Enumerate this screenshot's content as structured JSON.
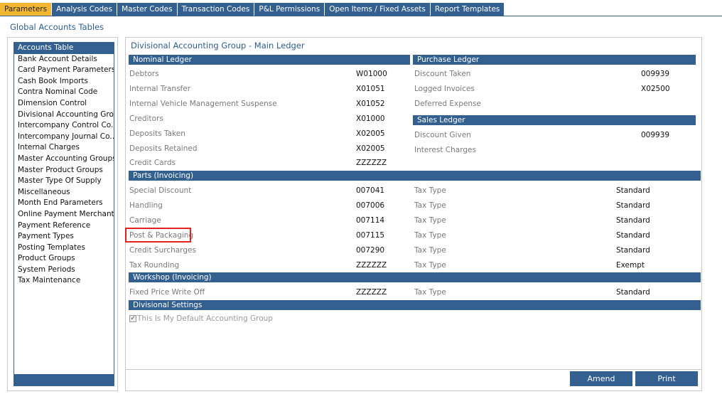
{
  "tabs": [
    {
      "label": "Parameters",
      "active": true
    },
    {
      "label": "Analysis Codes",
      "active": false
    },
    {
      "label": "Master Codes",
      "active": false
    },
    {
      "label": "Transaction Codes",
      "active": false
    },
    {
      "label": "P&L Permissions",
      "active": false
    },
    {
      "label": "Open Items / Fixed Assets",
      "active": false
    },
    {
      "label": "Report Templates",
      "active": false
    }
  ],
  "global_title": "Global Accounts Tables",
  "left_list": [
    "Accounts Table",
    "Bank Account Details",
    "Card Payment Parameters",
    "Cash Book Imports",
    "Contra Nominal Code",
    "Dimension Control",
    "Divisional Accounting Gro...",
    "Intercompany Control Co...",
    "Intercompany Journal Co...",
    "Internal Charges",
    "Master Accounting Groups",
    "Master Product Groups",
    "Master Type Of Supply",
    "Miscellaneous",
    "Month End Parameters",
    "Online Payment Merchants",
    "Payment Reference",
    "Payment Types",
    "Posting Templates",
    "Product Groups",
    "System Periods",
    "Tax Maintenance"
  ],
  "selected_index": 0,
  "main_title": "Divisional Accounting Group - Main Ledger",
  "nominal_ledger": {
    "title": "Nominal Ledger",
    "rows": [
      {
        "label": "Debtors",
        "value": "W01000"
      },
      {
        "label": "Internal Transfer",
        "value": "X01051"
      },
      {
        "label": "Internal Vehicle Management Suspense",
        "value": "X01052"
      },
      {
        "label": "Creditors",
        "value": "X01000"
      },
      {
        "label": "Deposits Taken",
        "value": "X02005"
      },
      {
        "label": "Deposits Retained",
        "value": "X02005"
      },
      {
        "label": "Credit Cards",
        "value": "ZZZZZZ"
      }
    ]
  },
  "purchase_ledger": {
    "title": "Purchase Ledger",
    "rows": [
      {
        "label": "Discount Taken",
        "value": "009939"
      },
      {
        "label": "Logged Invoices",
        "value": "X02500"
      },
      {
        "label": "Deferred Expense",
        "value": ""
      }
    ]
  },
  "sales_ledger": {
    "title": "Sales Ledger",
    "rows": [
      {
        "label": "Discount Given",
        "value": "009939"
      },
      {
        "label": "Interest Charges",
        "value": ""
      }
    ]
  },
  "parts_invoicing": {
    "title": "Parts (Invoicing)",
    "rows": [
      {
        "label": "Special Discount",
        "value": "007041",
        "tax_label": "Tax Type",
        "tax_value": "Standard"
      },
      {
        "label": "Handling",
        "value": "007006",
        "tax_label": "Tax Type",
        "tax_value": "Standard"
      },
      {
        "label": "Carriage",
        "value": "007114",
        "tax_label": "Tax Type",
        "tax_value": "Standard"
      },
      {
        "label": "Post & Packaging",
        "value": "007115",
        "tax_label": "Tax Type",
        "tax_value": "Standard"
      },
      {
        "label": "Credit Surcharges",
        "value": "007290",
        "tax_label": "Tax Type",
        "tax_value": "Standard"
      },
      {
        "label": "Tax Rounding",
        "value": "ZZZZZZ",
        "tax_label": "Tax Type",
        "tax_value": "Exempt"
      }
    ]
  },
  "workshop_invoicing": {
    "title": "Workshop (Invoicing)",
    "rows": [
      {
        "label": "Fixed Price Write Off",
        "value": "ZZZZZZ",
        "tax_label": "Tax Type",
        "tax_value": "Standard"
      }
    ]
  },
  "divisional_settings": {
    "title": "Divisional Settings",
    "default_group_label": "This Is My Default Accounting Group",
    "default_group_checked": true
  },
  "buttons": {
    "amend_label": "Amend",
    "print_label": "Print"
  },
  "colors": {
    "tab_active": "#f2b631",
    "bar": "#33608f",
    "highlight": "#e0231d"
  }
}
